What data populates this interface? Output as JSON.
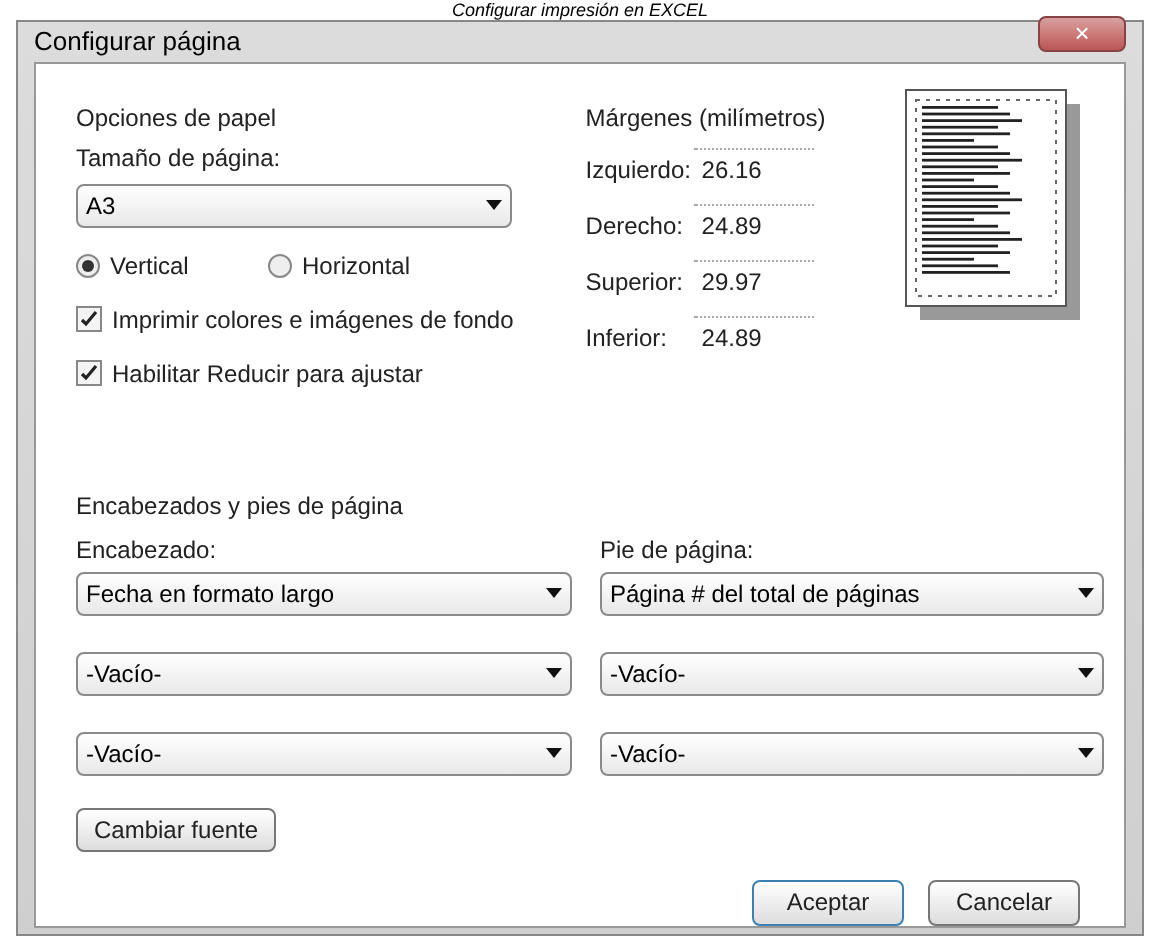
{
  "caption": "Configurar impresión en EXCEL",
  "window": {
    "title": "Configurar página",
    "close": "×"
  },
  "paper": {
    "title": "Opciones de papel",
    "size_label": "Tamaño de página:",
    "size_value": "A3",
    "orientation": [
      {
        "label": "Vertical",
        "selected": true
      },
      {
        "label": "Horizontal",
        "selected": false
      }
    ],
    "options": [
      {
        "label": "Imprimir colores e imágenes de fondo",
        "checked": true
      },
      {
        "label": "Habilitar Reducir para ajustar",
        "checked": true
      }
    ]
  },
  "margins": {
    "title": "Márgenes (milímetros)",
    "fields": [
      {
        "label": "Izquierdo:",
        "value": "26.16"
      },
      {
        "label": "Derecho:",
        "value": "24.89"
      },
      {
        "label": "Superior:",
        "value": "29.97"
      },
      {
        "label": "Inferior:",
        "value": "24.89"
      }
    ]
  },
  "headers_footers": {
    "title": "Encabezados y pies de página",
    "header_label": "Encabezado:",
    "footer_label": "Pie de página:",
    "header": [
      "Fecha en formato largo",
      "-Vacío-",
      "-Vacío-"
    ],
    "footer": [
      "Página # del total de páginas",
      "-Vacío-",
      "-Vacío-"
    ],
    "font_button": "Cambiar fuente"
  },
  "buttons": [
    "Aceptar",
    "Cancelar"
  ]
}
